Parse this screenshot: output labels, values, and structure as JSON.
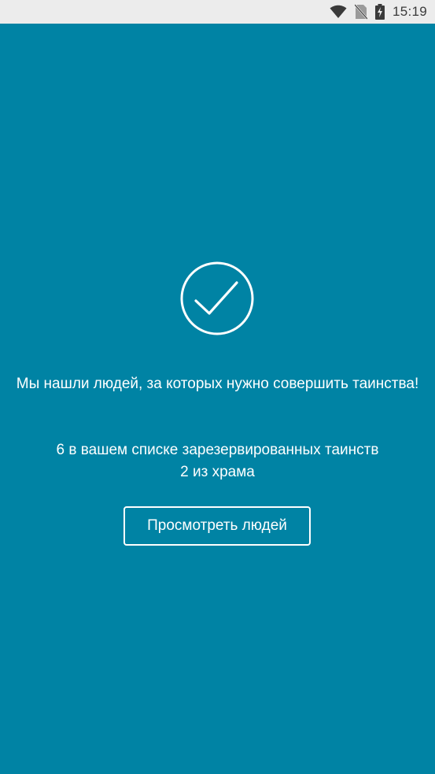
{
  "status_bar": {
    "time": "15:19",
    "icons": [
      "wifi-icon",
      "no-sim-icon",
      "battery-charging-icon"
    ],
    "background": "#ececec"
  },
  "screen": {
    "background": "#0083a4",
    "icon": "checkmark-circle-icon",
    "headline": "Мы нашли людей, за которых нужно совершить таинства!",
    "detail_line_1": "6 в вашем списке зарезервированных таинств",
    "detail_line_2": "2 из храма",
    "view_people_button": "Просмотреть людей"
  }
}
